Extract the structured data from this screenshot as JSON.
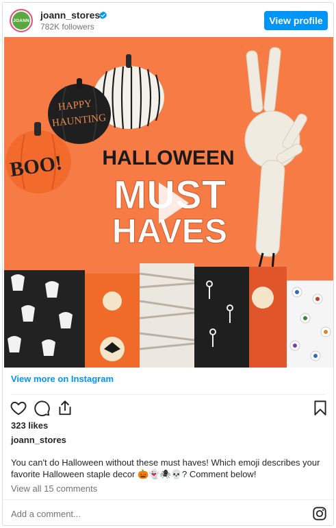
{
  "header": {
    "avatar_text": "JOANN",
    "username": "joann_stores",
    "followers": "782K followers",
    "view_profile_label": "View profile"
  },
  "media": {
    "headline_line1": "HALLOWEEN",
    "headline_line2": "MUST",
    "headline_line3": "HAVES",
    "pumpkin_text_1": "HAPPY",
    "pumpkin_text_2": "HAUNTING",
    "pumpkin_text_3": "BOO!",
    "background_color": "#f77b45"
  },
  "view_more_label": "View more on Instagram",
  "actions": {
    "like_icon": "heart-icon",
    "comment_icon": "comment-icon",
    "share_icon": "share-icon",
    "save_icon": "bookmark-icon"
  },
  "likes": "323 likes",
  "post_username": "joann_stores",
  "caption": "You can't do Halloween without these must haves! Which emoji describes your favorite Halloween staple decor 🎃👻🕷💀? Comment below!",
  "view_comments": "View all 15 comments",
  "add_comment_placeholder": "Add a comment...",
  "colors": {
    "accent": "#0095f6",
    "muted": "#737373",
    "text": "#262626"
  }
}
